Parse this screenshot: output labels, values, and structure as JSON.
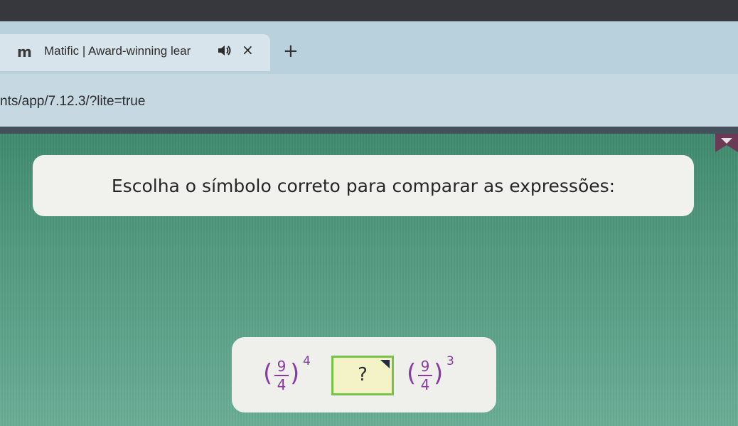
{
  "browser": {
    "tab": {
      "logo": "m",
      "title": "Matific | Award-winning lear",
      "close_label": "×",
      "audio_icon": "speaker-icon"
    },
    "new_tab_label": "+",
    "address_bar": {
      "url": "nts/app/7.12.3/?lite=true"
    }
  },
  "game": {
    "instruction": "Escolha o símbolo correto para comparar as expressões:",
    "question": {
      "left": {
        "numerator": "9",
        "denominator": "4",
        "exponent": "4",
        "open_paren": "(",
        "close_paren": ")"
      },
      "answer_placeholder": "?",
      "right": {
        "numerator": "9",
        "denominator": "4",
        "exponent": "3",
        "open_paren": "(",
        "close_paren": ")"
      }
    },
    "colors": {
      "background": "#529a80",
      "card": "#eff0ec",
      "expression": "#8a3aa6",
      "answer_fill": "#f4f3c8",
      "answer_border": "#79c24a",
      "ribbon": "#6b3a57"
    }
  }
}
